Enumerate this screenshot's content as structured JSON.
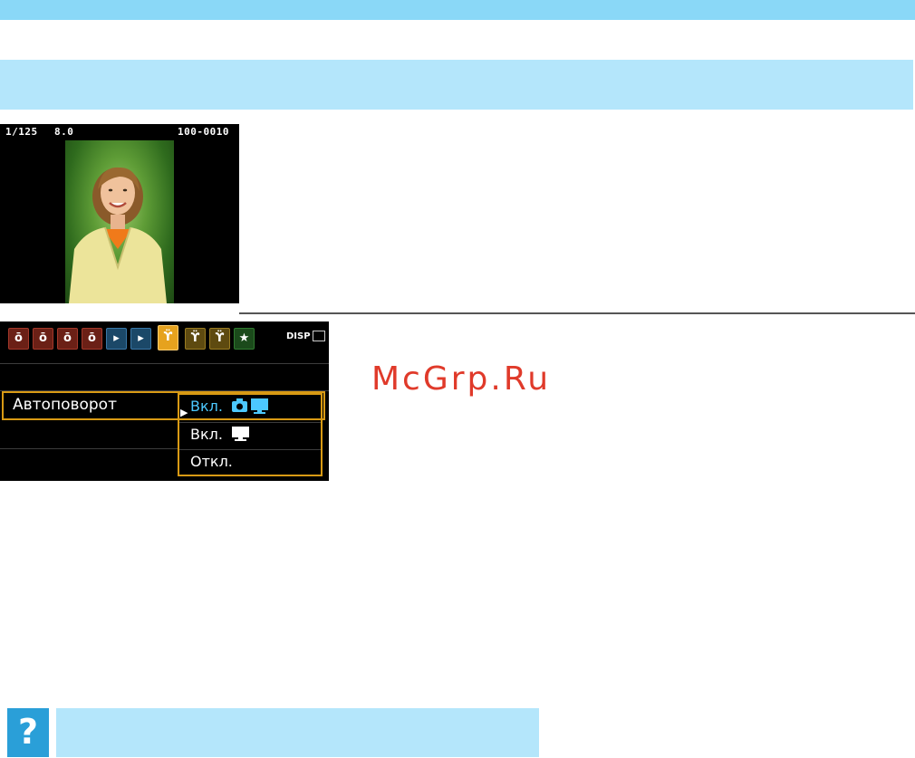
{
  "lcd": {
    "shutter": "1/125",
    "aperture": "8.0",
    "file_number": "100-0010"
  },
  "menu": {
    "tabs": [
      {
        "icon": "shooting-tab-1-icon",
        "color": "#6b2016"
      },
      {
        "icon": "shooting-tab-2-icon",
        "color": "#6b2016"
      },
      {
        "icon": "shooting-tab-3-icon",
        "color": "#6b2016"
      },
      {
        "icon": "shooting-tab-4-icon",
        "color": "#6b2016"
      },
      {
        "icon": "playback-tab-1-icon",
        "color": "#1b4868"
      },
      {
        "icon": "playback-tab-2-icon",
        "color": "#1b4868"
      },
      {
        "icon": "setup-tab-1-icon",
        "color": "#e6a21e",
        "selected": true
      },
      {
        "icon": "setup-tab-2-icon",
        "color": "#5e4a10"
      },
      {
        "icon": "setup-tab-3-icon",
        "color": "#5e4a10"
      },
      {
        "icon": "my-menu-tab-icon",
        "color": "#1b4a1b"
      }
    ],
    "disp_label": "DISP",
    "item_label": "Автоповорот",
    "options": [
      {
        "label": "Вкл.",
        "icons": [
          "camera-icon",
          "monitor-icon"
        ],
        "selected": true
      },
      {
        "label": "Вкл.",
        "icons": [
          "monitor-icon"
        ],
        "selected": false
      },
      {
        "label": "Откл.",
        "icons": [],
        "selected": false
      }
    ],
    "accent_color": "#d89a14",
    "selected_text_color": "#4cc8ff"
  },
  "watermark": "McGrp.Ru",
  "help_icon": "?",
  "colors": {
    "band": "#b4e6fb",
    "top_band": "#8ad8f7",
    "help_box": "#2a9fd8"
  }
}
